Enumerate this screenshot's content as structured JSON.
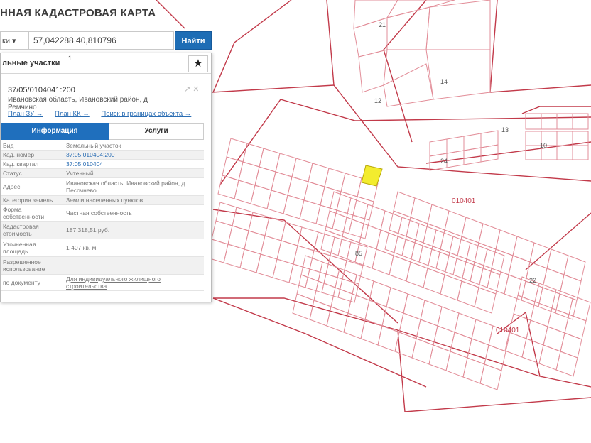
{
  "app": {
    "title": "ННАЯ КАДАСТРОВАЯ КАРТА"
  },
  "search": {
    "type_label": "ки ▾",
    "query": "57,042288 40,810796",
    "button_label": "Найти"
  },
  "panel": {
    "layer_title": "льные участки",
    "layer_count": "1",
    "star_icon": "★",
    "object_number": "37/05/0104041:200",
    "object_address": "Ивановская область, Ивановский район, д Ремчино",
    "close_icon": "↗ ✕",
    "links": [
      "План ЗУ →",
      "План КК →",
      "Поиск в границах объекта →"
    ],
    "tabs": [
      {
        "label": "Информация"
      },
      {
        "label": "Услуги"
      }
    ],
    "attributes": [
      {
        "key": "Вид",
        "value": "Земельный участок"
      },
      {
        "key": "Кад. номер",
        "value": "37:05:010404:200"
      },
      {
        "key": "Кад. квартал",
        "value": "37:05:010404"
      },
      {
        "key": "Статус",
        "value": "Учтенный"
      },
      {
        "key": "Адрес",
        "value": "Ивановская область, Ивановский район, д. Песочнево"
      },
      {
        "key": "Категория земель",
        "value": "Земли населенных пунктов"
      },
      {
        "key": "Форма собственности",
        "value": "Частная собственность"
      },
      {
        "key": "Кадастровая стоимость",
        "value": "187 318,51 руб."
      },
      {
        "key": "Уточненная площадь",
        "value": "1 407 кв. м"
      },
      {
        "key": "Разрешенное использование",
        "value": ""
      },
      {
        "key": "по документу",
        "value": "Для индивидуального жилищного строительства"
      }
    ]
  },
  "map": {
    "colors": {
      "boundary": "#c23a4a",
      "parcel": "#e28d98",
      "selected": "#f3ec2e",
      "background": "#ffffff"
    },
    "parcel_labels": [
      "21",
      "14",
      "12",
      "10",
      "13",
      "24",
      "85",
      "22"
    ],
    "quarter_labels": [
      "010401",
      "010401"
    ]
  }
}
